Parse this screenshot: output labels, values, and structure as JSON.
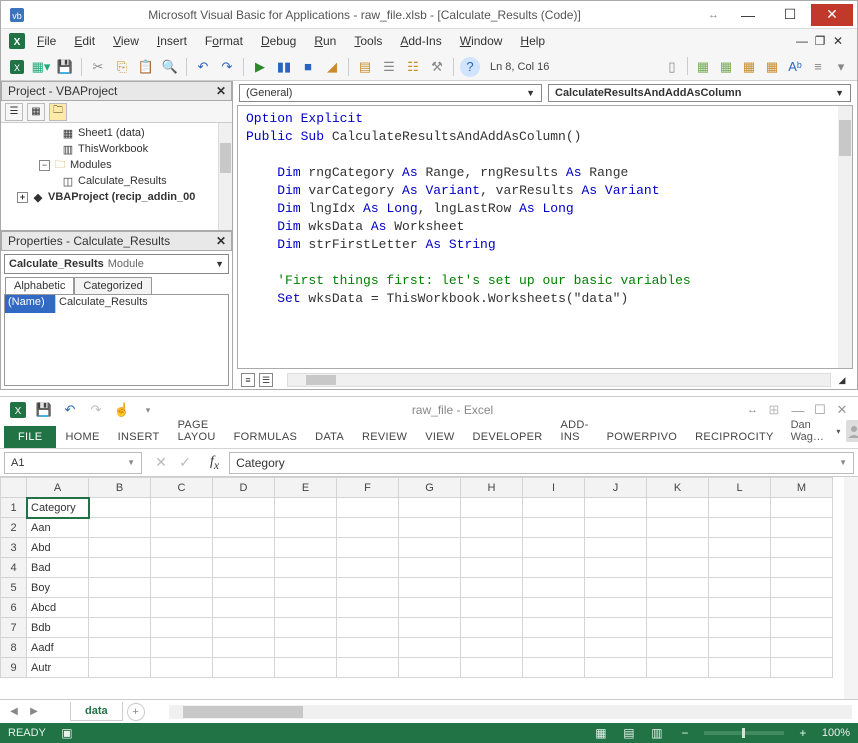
{
  "vbe": {
    "title": "Microsoft Visual Basic for Applications - raw_file.xlsb - [Calculate_Results (Code)]",
    "menu": [
      "File",
      "Edit",
      "View",
      "Insert",
      "Format",
      "Debug",
      "Run",
      "Tools",
      "Add-Ins",
      "Window",
      "Help"
    ],
    "cursor_status": "Ln 8, Col 16",
    "project": {
      "title_text": "Project - VBAProject",
      "tree": {
        "sheet1": "Sheet1 (data)",
        "thisworkbook": "ThisWorkbook",
        "modules": "Modules",
        "module1": "Calculate_Results",
        "addin": "VBAProject (recip_addin_00"
      }
    },
    "properties": {
      "title_text": "Properties - Calculate_Results",
      "combo_name": "Calculate_Results",
      "combo_type": "Module",
      "tabs": {
        "alphabetic": "Alphabetic",
        "categorized": "Categorized"
      },
      "row_name_label": "(Name)",
      "row_name_value": "Calculate_Results"
    },
    "code": {
      "object_combo": "(General)",
      "proc_combo": "CalculateResultsAndAddAsColumn",
      "lines": [
        {
          "t": "Option Explicit",
          "cls": "kw"
        },
        {
          "t": "Public Sub CalculateResultsAndAddAsColumn()",
          "cls": "kw-mixed"
        },
        {
          "t": ""
        },
        {
          "t": "    Dim rngCategory As Range, rngResults As Range",
          "cls": "dim"
        },
        {
          "t": "    Dim varCategory As Variant, varResults As Variant",
          "cls": "dim"
        },
        {
          "t": "    Dim lngIdx As Long, lngLastRow As Long",
          "cls": "dim"
        },
        {
          "t": "    Dim wksData As Worksheet",
          "cls": "dim"
        },
        {
          "t": "    Dim strFirstLetter As String",
          "cls": "dim"
        },
        {
          "t": ""
        },
        {
          "t": "    'First things first: let's set up our basic variables",
          "cls": "cm"
        },
        {
          "t": "    Set wksData = ThisWorkbook.Worksheets(\"data\")",
          "cls": "set"
        }
      ]
    }
  },
  "excel": {
    "title": "raw_file - Excel",
    "ribbon_tabs": [
      "FILE",
      "HOME",
      "INSERT",
      "PAGE LAYOU",
      "FORMULAS",
      "DATA",
      "REVIEW",
      "VIEW",
      "DEVELOPER",
      "ADD-INS",
      "POWERPIVO",
      "RECIPROCITY"
    ],
    "user": "Dan Wag…",
    "namebox": "A1",
    "formula_value": "Category",
    "columns": [
      "A",
      "B",
      "C",
      "D",
      "E",
      "F",
      "G",
      "H",
      "I",
      "J",
      "K",
      "L",
      "M"
    ],
    "rows": [
      {
        "n": "1",
        "A": "Category"
      },
      {
        "n": "2",
        "A": "Aan"
      },
      {
        "n": "3",
        "A": "Abd"
      },
      {
        "n": "4",
        "A": "Bad"
      },
      {
        "n": "5",
        "A": "Boy"
      },
      {
        "n": "6",
        "A": "Abcd"
      },
      {
        "n": "7",
        "A": "Bdb"
      },
      {
        "n": "8",
        "A": "Aadf"
      },
      {
        "n": "9",
        "A": "Autr"
      }
    ],
    "sheet_tab": "data",
    "status": {
      "ready": "READY",
      "zoom": "100%"
    }
  }
}
